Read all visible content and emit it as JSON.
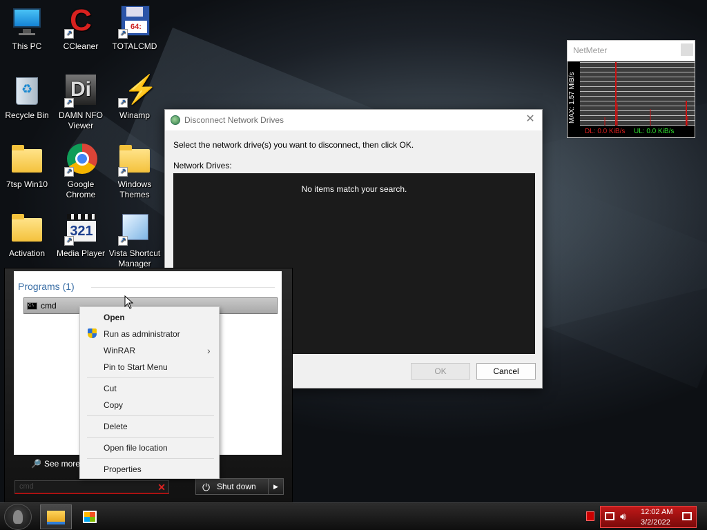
{
  "desktop": {
    "icons": [
      {
        "label": "This PC",
        "icon": "computer-icon"
      },
      {
        "label": "CCleaner",
        "icon": "ccleaner-icon"
      },
      {
        "label": "TOTALCMD",
        "icon": "floppy-icon"
      },
      {
        "label": "Recycle Bin",
        "icon": "recycle-bin-icon"
      },
      {
        "label": "DAMN NFO Viewer",
        "icon": "nfo-viewer-icon"
      },
      {
        "label": "Winamp",
        "icon": "winamp-icon"
      },
      {
        "label": "7tsp Win10",
        "icon": "folder-icon"
      },
      {
        "label": "Google Chrome",
        "icon": "chrome-icon"
      },
      {
        "label": "Windows Themes",
        "icon": "folder-icon"
      },
      {
        "label": "Activation",
        "icon": "folder-icon"
      },
      {
        "label": "Media Player",
        "icon": "media-player-icon"
      },
      {
        "label": "Vista Shortcut Manager",
        "icon": "shortcut-manager-icon"
      }
    ],
    "ccleaner_letter": "C",
    "totalcmd_badge": "64:",
    "nfo_letter": "Di",
    "media_player_digits": "321"
  },
  "dialog": {
    "title": "Disconnect Network Drives",
    "message": "Select the network drive(s) you want to disconnect, then click OK.",
    "list_label": "Network Drives:",
    "empty_text": "No items match your search.",
    "ok_label": "OK",
    "cancel_label": "Cancel",
    "close_glyph": "✕"
  },
  "netmeter": {
    "title": "NetMeter",
    "max_label": "MAX: 1.57 MiB/s",
    "dl": "DL: 0.0 KiB/s",
    "ul": "UL: 0.0 KiB/s",
    "colors": {
      "dl": "#e02020",
      "ul": "#30e030"
    }
  },
  "start_menu": {
    "section_header": "Programs (1)",
    "result_label": "cmd",
    "result_icon_text": "C:\\",
    "see_more": "See more results",
    "search_value": "cmd",
    "clear_glyph": "✕",
    "shutdown_label": "Shut down",
    "power_glyph": "⏻",
    "arrow_glyph": "▶"
  },
  "context_menu": {
    "items": [
      "Open",
      "Run as administrator",
      "WinRAR",
      "Pin to Start Menu",
      "Cut",
      "Copy",
      "Delete",
      "Open file location",
      "Properties"
    ],
    "submenu_glyph": "›"
  },
  "taskbar": {
    "time": "12:02 AM",
    "date": "3/2/2022",
    "accent": "#c01818"
  }
}
